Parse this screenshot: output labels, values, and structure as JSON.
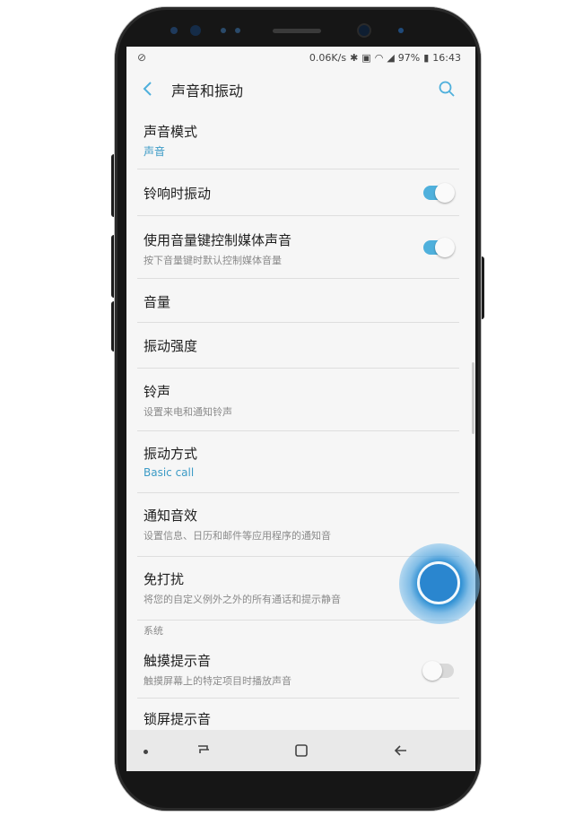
{
  "status": {
    "left_icon": "no-disturb-icon",
    "network_speed": "0.06K/s",
    "battery": "97%",
    "time": "16:43"
  },
  "header": {
    "title": "声音和振动"
  },
  "settings": {
    "sound_mode": {
      "title": "声音模式",
      "value": "声音"
    },
    "vibrate_ring": {
      "title": "铃响时振动",
      "on": true
    },
    "volume_keys": {
      "title": "使用音量键控制媒体声音",
      "sub": "按下音量键时默认控制媒体音量",
      "on": true
    },
    "volume": {
      "title": "音量"
    },
    "vibration_intensity": {
      "title": "振动强度"
    },
    "ringtone": {
      "title": "铃声",
      "sub": "设置来电和通知铃声"
    },
    "vibration_pattern": {
      "title": "振动方式",
      "value": "Basic call"
    },
    "notification_sound": {
      "title": "通知音效",
      "sub": "设置信息、日历和邮件等应用程序的通知音"
    },
    "dnd": {
      "title": "免打扰",
      "sub": "将您的自定义例外之外的所有通话和提示静音"
    },
    "system_header": "系统",
    "touch_sound": {
      "title": "触摸提示音",
      "sub": "触摸屏幕上的特定项目时播放声音",
      "on": false
    },
    "next_partial": "锁屏提示音"
  },
  "colors": {
    "accent": "#4fb0dc",
    "touch": "#2a86cf"
  }
}
